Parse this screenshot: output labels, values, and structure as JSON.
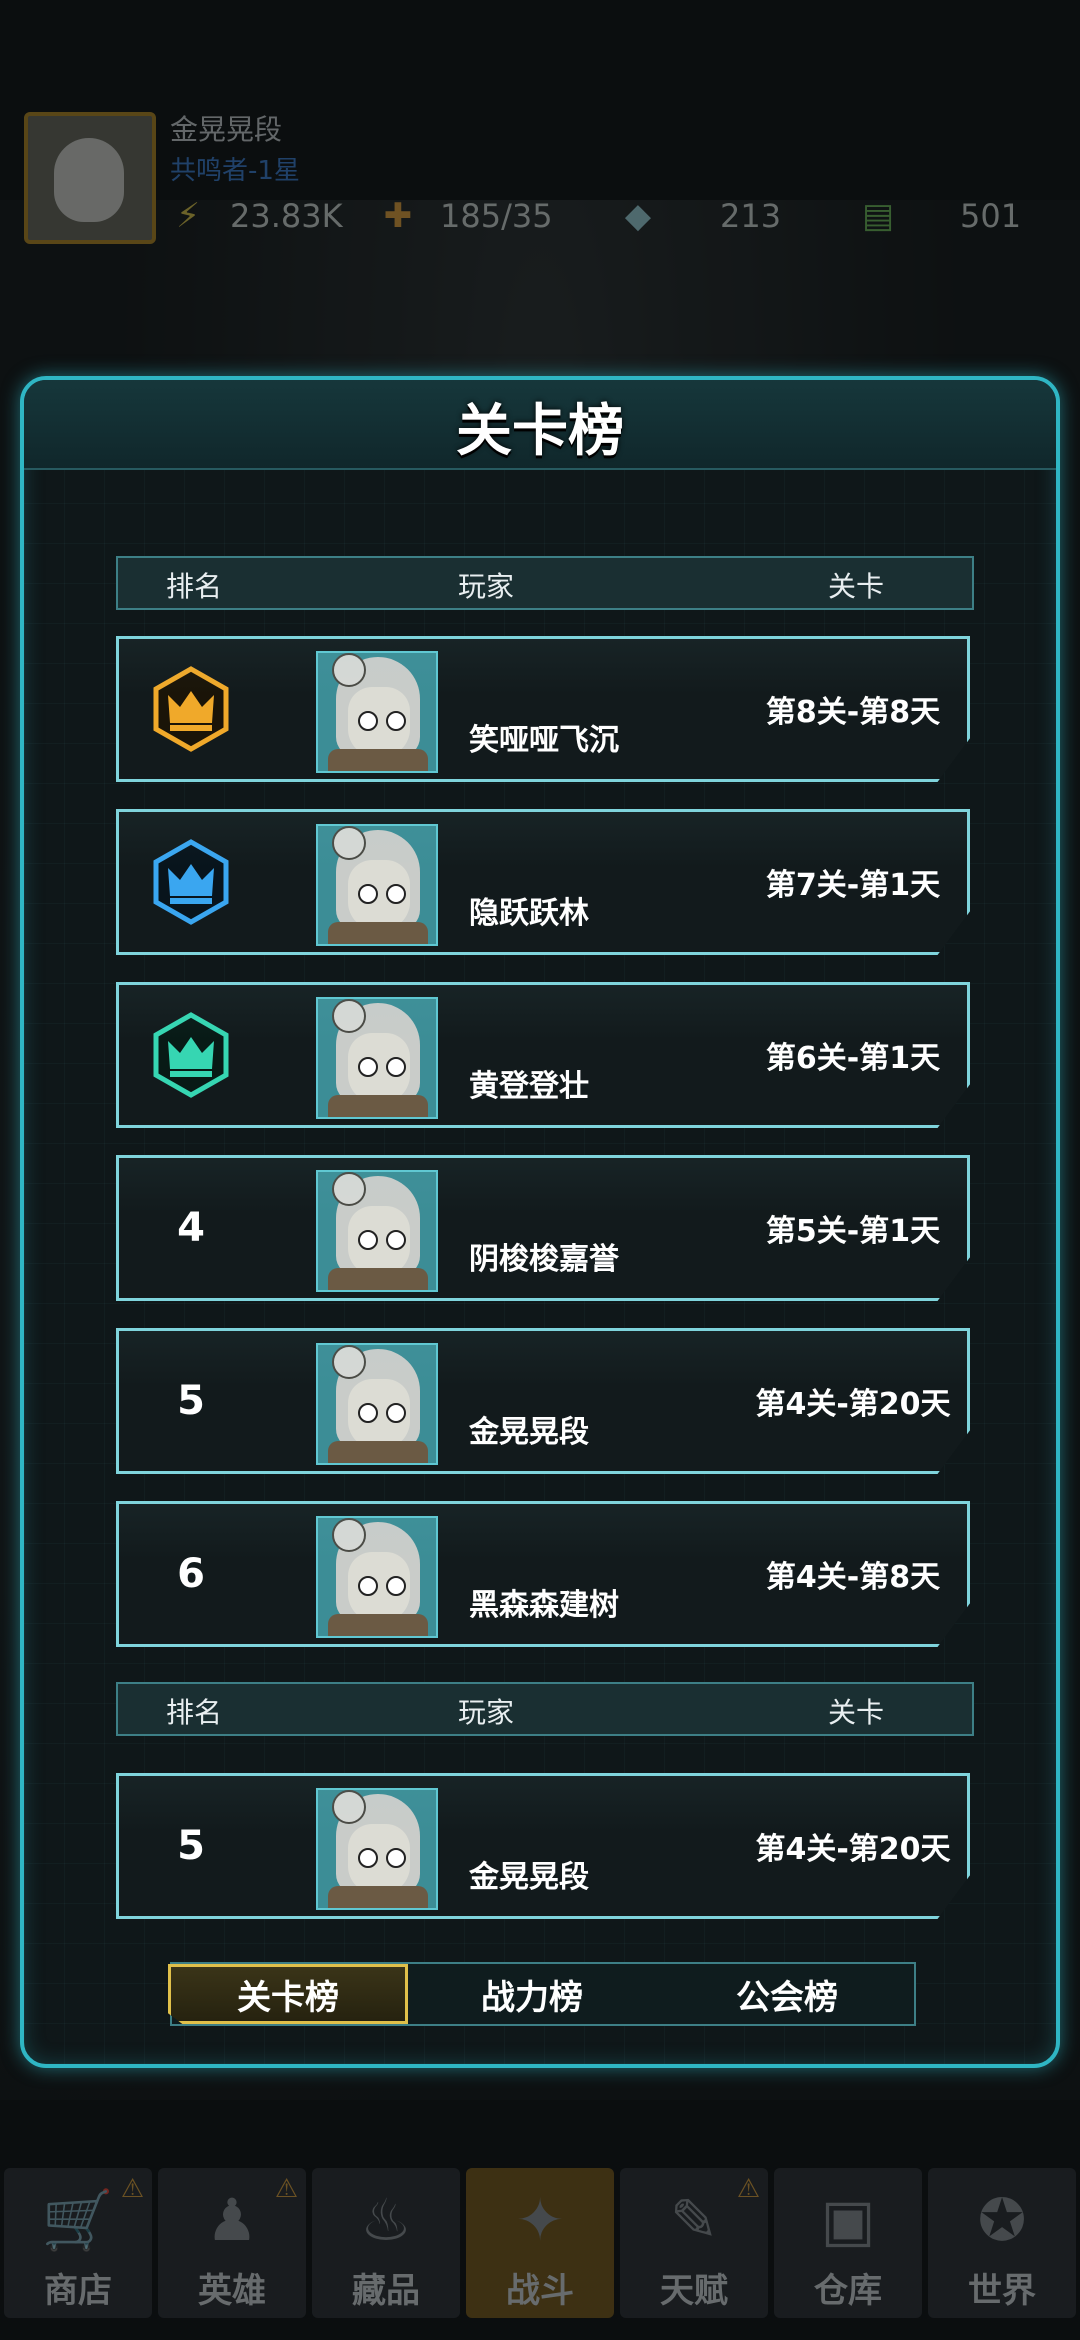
{
  "player": {
    "name": "金晃晃段",
    "title": "共鸣者-1星"
  },
  "resources": [
    {
      "icon": "energy-icon",
      "glyph": "⚡",
      "value": "23.83K",
      "color": "#e0c84a"
    },
    {
      "icon": "stamina-icon",
      "glyph": "✚",
      "value": "185/35",
      "color": "#e8a63c"
    },
    {
      "icon": "diamond-icon",
      "glyph": "◆",
      "value": "213",
      "color": "#9fd8e0"
    },
    {
      "icon": "cash-icon",
      "glyph": "▤",
      "value": "501",
      "color": "#6fbf5a"
    }
  ],
  "panel": {
    "title": "关卡榜"
  },
  "columns": {
    "rank": "排名",
    "player": "玩家",
    "stage": "关卡"
  },
  "rows": [
    {
      "rank": "1",
      "crown": "gold",
      "crown_color": "#f0a92a",
      "name": "笑哑哑飞沉",
      "stage": "第8关-第8天"
    },
    {
      "rank": "2",
      "crown": "blue",
      "crown_color": "#3aa6f0",
      "name": "隐跃跃林",
      "stage": "第7关-第1天"
    },
    {
      "rank": "3",
      "crown": "teal",
      "crown_color": "#36d6b2",
      "name": "黄登登壮",
      "stage": "第6关-第1天"
    },
    {
      "rank": "4",
      "name": "阴梭梭嘉誉",
      "stage": "第5关-第1天"
    },
    {
      "rank": "5",
      "name": "金晃晃段",
      "stage": "第4关-第20天"
    },
    {
      "rank": "6",
      "name": "黑森森建树",
      "stage": "第4关-第8天"
    }
  ],
  "self_row": {
    "rank": "5",
    "name": "金晃晃段",
    "stage": "第4关-第20天"
  },
  "tabs": [
    {
      "label": "关卡榜",
      "active": true
    },
    {
      "label": "战力榜",
      "active": false
    },
    {
      "label": "公会榜",
      "active": false
    }
  ],
  "nav": [
    {
      "label": "商店",
      "icon": "cart-icon",
      "glyph": "🛒",
      "alert": true
    },
    {
      "label": "英雄",
      "icon": "hero-icon",
      "glyph": "♟",
      "alert": true
    },
    {
      "label": "藏品",
      "icon": "flame-icon",
      "glyph": "♨",
      "alert": false
    },
    {
      "label": "战斗",
      "icon": "rifle-icon",
      "glyph": "✦",
      "alert": false,
      "active": true
    },
    {
      "label": "天赋",
      "icon": "dna-icon",
      "glyph": "✎",
      "alert": true
    },
    {
      "label": "仓库",
      "icon": "crate-icon",
      "glyph": "▣",
      "alert": false
    },
    {
      "label": "世界",
      "icon": "world-icon",
      "glyph": "✪",
      "alert": false
    }
  ]
}
